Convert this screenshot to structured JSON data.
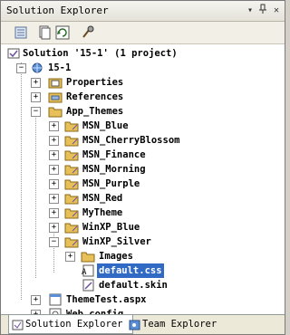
{
  "window": {
    "title": "Solution Explorer",
    "buttons": [
      "pin-icon",
      "close-icon"
    ]
  },
  "toolbar": {
    "icons": [
      "properties-icon",
      "show-all-files-icon",
      "refresh-icon",
      "view-code-icon"
    ]
  },
  "tree": {
    "solution": "Solution '15-1' (1 project)",
    "project": "15-1",
    "items": {
      "properties": "Properties",
      "references": "References",
      "app_themes": "App_Themes",
      "msn_blue": "MSN_Blue",
      "msn_cherry": "MSN_CherryBlossom",
      "msn_finance": "MSN_Finance",
      "msn_morning": "MSN_Morning",
      "msn_purple": "MSN_Purple",
      "msn_red": "MSN_Red",
      "mytheme": "MyTheme",
      "winxp_blue": "WinXP_Blue",
      "winxp_silver": "WinXP_Silver",
      "images": "Images",
      "default_css": "default.css",
      "default_skin": "default.skin",
      "themetest": "ThemeTest.aspx",
      "webconfig": "Web.config"
    }
  },
  "tabs": {
    "solution_explorer": "Solution Explorer",
    "team_explorer": "Team Explorer"
  },
  "colors": {
    "selection": "#316ac5",
    "folder": "#e8c05a"
  }
}
